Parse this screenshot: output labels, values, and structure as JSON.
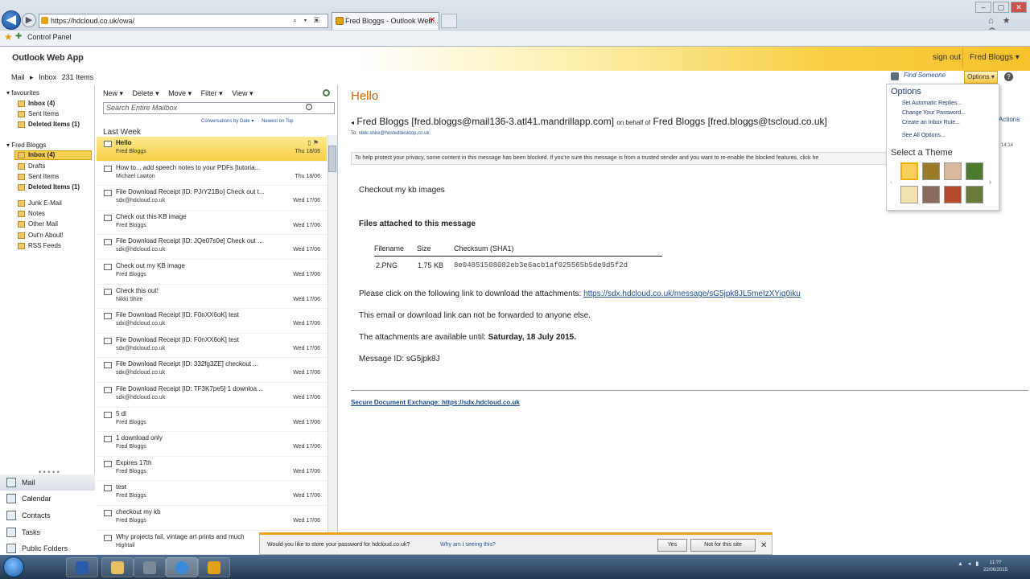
{
  "browser": {
    "address": "https://hdcloud.co.uk/owa/",
    "tab_title": "Fred Bloggs - Outlook Web...",
    "favorites": [
      "Control Panel"
    ]
  },
  "owa": {
    "app_name": "Outlook Web App",
    "sign_out": "sign out",
    "user_name": "Fred Bloggs ▾",
    "find_someone": "Find Someone",
    "options_button": "Options ▾",
    "help": "?"
  },
  "breadcrumb": {
    "mail": "Mail",
    "sep": "▸",
    "inbox": "Inbox",
    "count": "231 Items"
  },
  "nav": {
    "favourites": "favourites",
    "fav_items": [
      "Inbox (4)",
      "Sent Items",
      "Deleted Items (1)"
    ],
    "mailbox": "Fred Bloggs",
    "mailbox_items": [
      "Inbox (4)",
      "Drafts",
      "Sent Items",
      "Deleted Items (1)",
      "Junk E-Mail",
      "Notes",
      "Other Mail",
      "Out'n About!",
      "RSS Feeds"
    ],
    "dots": "• • • • •",
    "bottom": [
      "Mail",
      "Calendar",
      "Contacts",
      "Tasks",
      "Public Folders"
    ]
  },
  "list": {
    "toolbar": [
      "New ▾",
      "Delete ▾",
      "Move ▾",
      "Filter ▾",
      "View ▾"
    ],
    "search_placeholder": "Search Entire Mailbox",
    "sort_by": "Conversations by Date ▾",
    "sort_order": "Newest on Top",
    "group": "Last Week",
    "messages": [
      {
        "subject": "Hello",
        "from": "Fred Bloggs",
        "date": "Thu 18/06"
      },
      {
        "subject": "How to... add speech notes to your PDFs [tutoria...",
        "from": "Michael Lawton",
        "date": "Thu 18/06"
      },
      {
        "subject": "File Download Receipt [ID: PJrY21Bo] Check out t...",
        "from": "sdx@hdcloud.co.uk",
        "date": "Wed 17/06"
      },
      {
        "subject": "Check out this KB image",
        "from": "Fred Bloggs",
        "date": "Wed 17/06"
      },
      {
        "subject": "File Download Receipt [ID: JQe07s0e] Check out ...",
        "from": "sdx@hdcloud.co.uk",
        "date": "Wed 17/06"
      },
      {
        "subject": "Check out my KB image",
        "from": "Fred Bloggs",
        "date": "Wed 17/06"
      },
      {
        "subject": "Check this out!",
        "from": "Nikki Shire",
        "date": "Wed 17/06"
      },
      {
        "subject": "File Download Receipt [ID: F0nXX6oK] test",
        "from": "sdx@hdcloud.co.uk",
        "date": "Wed 17/06"
      },
      {
        "subject": "File Download Receipt [ID: F0nXX6oK] test",
        "from": "sdx@hdcloud.co.uk",
        "date": "Wed 17/06"
      },
      {
        "subject": "File Download Receipt [ID: 332fg3ZE] checkout ...",
        "from": "sdx@hdcloud.co.uk",
        "date": "Wed 17/06"
      },
      {
        "subject": "File Download Receipt [ID: TF3K7pe5] 1 downloa...",
        "from": "sdx@hdcloud.co.uk",
        "date": "Wed 17/06"
      },
      {
        "subject": "5 dl",
        "from": "Fred Bloggs",
        "date": "Wed 17/06"
      },
      {
        "subject": "1 download only",
        "from": "Fred Bloggs",
        "date": "Wed 17/06"
      },
      {
        "subject": "Expires 17th",
        "from": "Fred Bloggs",
        "date": "Wed 17/06"
      },
      {
        "subject": "test",
        "from": "Fred Bloggs",
        "date": "Wed 17/06"
      },
      {
        "subject": "checkout my kb",
        "from": "Fred Bloggs",
        "date": "Wed 17/06"
      },
      {
        "subject": "Why projects fail, vintage art prints and much",
        "from": "Hightail",
        "date": "Wed 17/06"
      }
    ]
  },
  "reading": {
    "title": "Hello",
    "sender": "Fred Bloggs [fred.bloggs@mail136-3.atl41.mandrillapp.com]",
    "on_behalf": "on behalf of",
    "behalf_name": "Fred Bloggs [fred.bloggs@tscloud.co.uk]",
    "to_label": "To:",
    "to": "nikki.shire@hosteddesktop.co.uk",
    "actions": "Actions",
    "right_cut": "14:14",
    "blocked": "To help protect your privacy, some content in this message has been blocked. If you're sure this message is from a trusted sender and you want to re-enable the blocked features, click he",
    "intro": "Checkout my kb images",
    "attach_heading": "Files attached to this message",
    "table_headers": [
      "Filename",
      "Size",
      "Checksum (SHA1)"
    ],
    "table_row": [
      "2.PNG",
      "1.75 KB",
      "8e04851508082eb3e6acb1af025565b5de9d5f2d"
    ],
    "click_text": "Please click on the following link to download the attachments: ",
    "link": "https://sdx.hdcloud.co.uk/message/sG5jpk8JL5meIzXYiq0iku",
    "forward_note": "This email or download link can not be forwarded to anyone else.",
    "available_prefix": "The attachments are available until: ",
    "available_date": "Saturday, 18 July 2015.",
    "message_id": "Message ID: sG5jpk8J",
    "secure_label": "Secure Document Exchange",
    "secure_sep": ": ",
    "secure_url": "https://sdx.hdcloud.co.uk"
  },
  "options_menu": {
    "title": "Options",
    "items": [
      "Set Automatic Replies...",
      "Change Your Password...",
      "Create an Inbox Rule..."
    ],
    "see_all": "See All Options...",
    "theme_title": "Select a Theme",
    "theme_colors": [
      "#f7cf5a",
      "#9a7a2a",
      "#d8b89a",
      "#4d7a2e",
      "#f2e0b0",
      "#8a6a5a",
      "#b64a2a",
      "#6a7a3a"
    ],
    "theme_next": "›",
    "theme_prev": "‹"
  },
  "password_bar": {
    "question": "Would you like to store your password for hdcloud.co.uk?",
    "why": "Why am I seeing this?",
    "yes": "Yes",
    "not": "Not for this site",
    "close": "✕"
  },
  "taskbar": {
    "clock_time": "11:??",
    "clock_date": "22/06/2015",
    "tray": "▲ ◂ ▮"
  }
}
